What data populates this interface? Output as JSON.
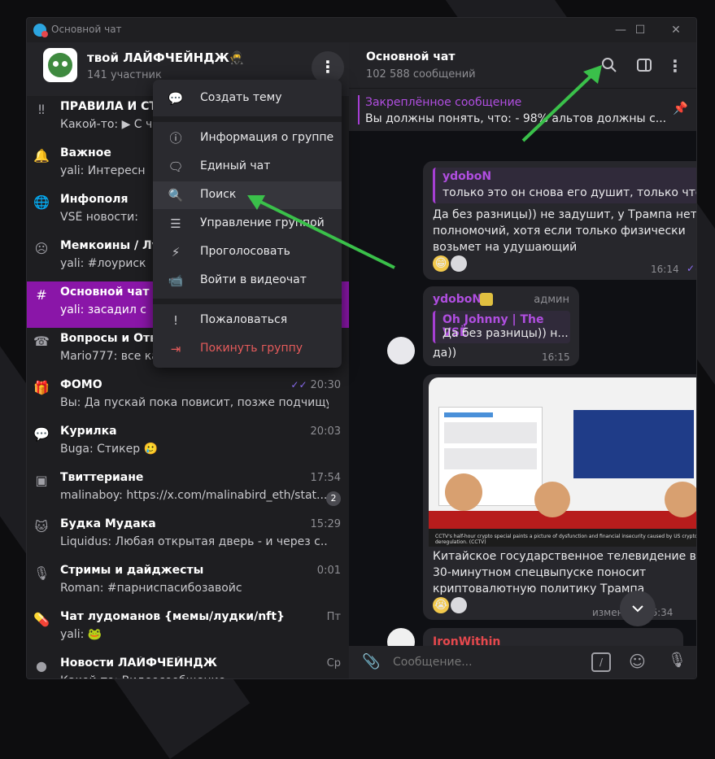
{
  "window": {
    "title": "Основной чат"
  },
  "group": {
    "name": "твой ЛАЙФЧЕЙНДЖ🥷",
    "members": "141 участник"
  },
  "chats": [
    {
      "icon": "‼",
      "name": "ПРАВИЛА И СТРУ",
      "preview": "Какой-то: ▶ С че",
      "time": "",
      "active": false
    },
    {
      "icon": "🔔",
      "name": "Важное",
      "preview": "yali: Интересн",
      "time": ""
    },
    {
      "icon": "🌐",
      "name": "Инфополя",
      "preview": "VSË новости:",
      "time": ""
    },
    {
      "icon": "☹",
      "name": "Мемкоины / Луд",
      "preview": "yali: #лоуриск",
      "time": ""
    },
    {
      "icon": "#",
      "name": "Основной чат",
      "preview": "yali: засадил с",
      "time": "",
      "active": true
    },
    {
      "icon": "☎",
      "name": "Вопросы и Ответ",
      "preview": "Mario777: все ка",
      "time": ""
    },
    {
      "icon": "🎁",
      "name": "ФОМО",
      "preview": "Вы: Да пускай пока повисит, позже подчищу",
      "time": "20:30",
      "read": true
    },
    {
      "icon": "💬",
      "name": "Курилка",
      "preview": "Buga: Стикер 🥲",
      "time": "20:03"
    },
    {
      "icon": "▣",
      "name": "Твиттериане",
      "preview": "malinaboy: https://x.com/malinabird_eth/stat...",
      "time": "17:54",
      "badge": "2"
    },
    {
      "icon": "🐱",
      "name": "Будка Мудака",
      "preview": "Liquidus: Любая открытая дверь - и через с...",
      "time": "15:29"
    },
    {
      "icon": "🎙",
      "name": "Стримы и дайджесты",
      "preview": "Roman: #парниспасибозавойс",
      "time": "0:01"
    },
    {
      "icon": "💊",
      "name": "Чат лудоманов {мемы/лудки/nft}",
      "preview": "yali: 🐸",
      "time": "Пт"
    },
    {
      "icon": "●",
      "name": "Новости ЛАЙФЧЕЙНДЖ",
      "preview": "Какой-то: Видеосообщение",
      "time": "Ср"
    }
  ],
  "menu": {
    "items": [
      {
        "icon": "💬",
        "label": "Создать тему"
      },
      {
        "icon": "ⓘ",
        "label": "Информация о группе"
      },
      {
        "icon": "🗨",
        "label": "Единый чат"
      },
      {
        "icon": "🔍",
        "label": "Поиск",
        "highlight": true
      },
      {
        "icon": "☰",
        "label": "Управление группой"
      },
      {
        "icon": "⚡",
        "label": "Проголосовать"
      },
      {
        "icon": "📹",
        "label": "Войти в видеочат"
      },
      {
        "icon": "!",
        "label": "Пожаловаться"
      },
      {
        "icon": "⇥",
        "label": "Покинуть группу",
        "danger": true
      }
    ]
  },
  "conversation": {
    "title": "Основной чат",
    "subtitle": "102 588 сообщений",
    "pinned": {
      "title": "Закреплённое сообщение",
      "text": "Вы должны понять, что: - 98% альтов должны с..."
    },
    "messages": [
      {
        "quote_name": "ydoboN",
        "quote_text": "только это он снова его душит, только что ...",
        "text": "Да без разницы)) не задушит, у Трампа нет полномочий, хотя если только физически возьмет на удушающий",
        "time": "16:14"
      },
      {
        "author": "ydoboN",
        "role": "админ",
        "quote_name": "Oh Johnny | The VSË",
        "quote_text": "Да без разницы)) н...",
        "text": "да))",
        "time": "16:15"
      },
      {
        "text": "Китайское государственное телевидение в 30-минутном спецвыпуске поносит криптовалютную политику Трампа",
        "time": "изменено 16:34"
      },
      {
        "author": "IronWithin"
      }
    ],
    "image_caption": "CCTV's half-hour crypto special paints a picture of dysfunction and financial insecurity caused by US crypto deregulation. (CCTV)"
  },
  "composer": {
    "placeholder": "Сообщение..."
  },
  "colors": {
    "accent": "#8a16a8",
    "quote": "#b04ee0",
    "arrow": "#3ac04a"
  }
}
